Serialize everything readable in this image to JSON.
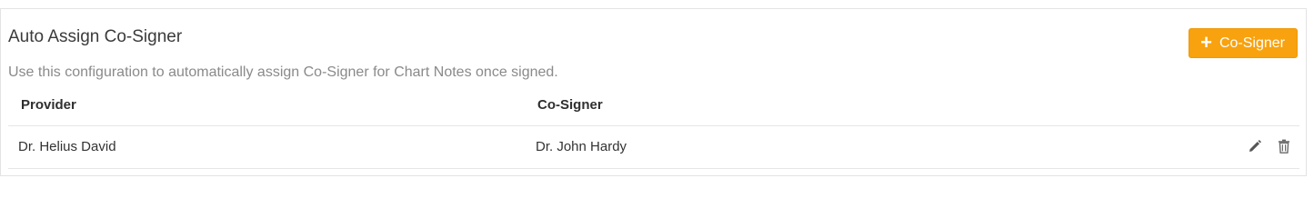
{
  "section": {
    "title": "Auto Assign Co-Signer",
    "description": "Use this configuration to automatically assign Co-Signer for Chart Notes once signed.",
    "add_button_label": "Co-Signer",
    "add_button_icon": "plus-icon",
    "accent_color": "#f8a20f"
  },
  "table": {
    "columns": [
      "Provider",
      "Co-Signer"
    ],
    "rows": [
      {
        "provider": "Dr. Helius David",
        "cosigner": "Dr. John Hardy",
        "actions": [
          "edit-icon",
          "delete-icon"
        ]
      }
    ]
  }
}
